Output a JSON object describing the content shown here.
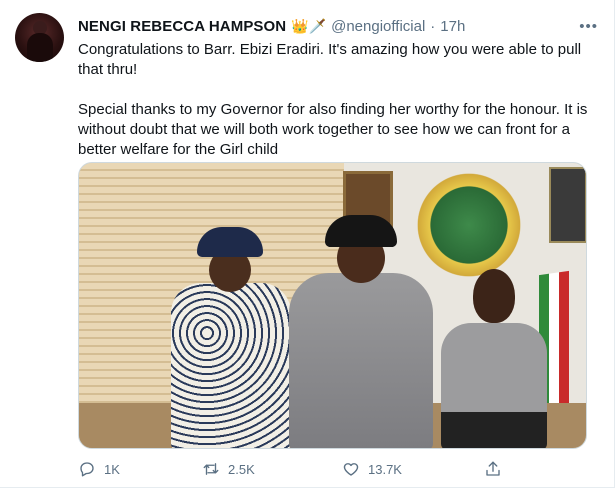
{
  "tweet": {
    "author_name": "NENGI REBECCA HAMPSON",
    "author_emojis": "👑🗡️",
    "handle": "@nengiofficial",
    "separator": "·",
    "time": "17h",
    "more_label": "•••",
    "paragraphs": [
      "Congratulations to Barr. Ebizi Eradiri. It's amazing how you were able to pull that thru!",
      "Special thanks to my Governor for also finding her worthy for the honour. It is without doubt that we will both work together to see how we can front for a better welfare for the Girl child"
    ]
  },
  "actions": {
    "reply_count": "1K",
    "retweet_count": "2.5K",
    "like_count": "13.7K"
  },
  "icons": {
    "reply": "reply-icon",
    "retweet": "retweet-icon",
    "like": "heart-icon",
    "share": "share-icon",
    "more": "more-icon"
  },
  "colors": {
    "text": "#0f1419",
    "secondary": "#5b7083",
    "border": "#cfd9de"
  }
}
